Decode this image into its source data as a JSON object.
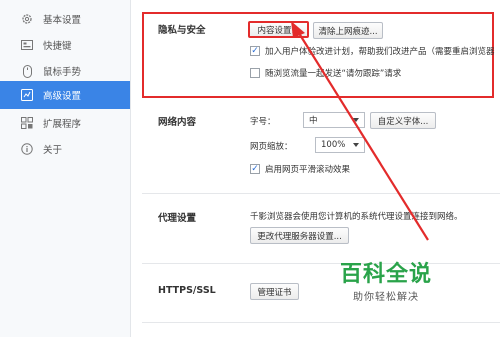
{
  "sidebar": {
    "items": [
      {
        "label": "基本设置",
        "icon": "gear-icon"
      },
      {
        "label": "快捷键",
        "icon": "keyboard-icon"
      },
      {
        "label": "鼠标手势",
        "icon": "mouse-icon"
      },
      {
        "label": "高级设置",
        "icon": "advanced-settings-icon",
        "active": true
      },
      {
        "label": "扩展程序",
        "icon": "extensions-icon"
      },
      {
        "label": "关于",
        "icon": "info-icon"
      }
    ]
  },
  "privacy": {
    "title": "隐私与安全",
    "content_settings_button": "内容设置...",
    "clear_history_button": "清除上网痕迹...",
    "checkbox_improve": {
      "label": "加入用户体验改进计划，帮助我们改进产品（需要重启浏览器",
      "checked": true
    },
    "checkbox_dnt": {
      "label": "随浏览流量一起发送“请勿跟踪”请求",
      "checked": false
    }
  },
  "web_content": {
    "title": "网络内容",
    "font_size_label": "字号：",
    "font_size_value": "中",
    "custom_font_button": "自定义字体...",
    "zoom_label": "网页缩放：",
    "zoom_value": "100%",
    "smooth_scroll": {
      "label": "启用网页平滑滚动效果",
      "checked": true
    }
  },
  "proxy": {
    "title": "代理设置",
    "description": "千影浏览器会使用您计算机的系统代理设置连接到网络。",
    "change_proxy_button": "更改代理服务器设置..."
  },
  "https": {
    "title": "HTTPS/SSL",
    "manage_certificates_button": "管理证书"
  },
  "watermark": {
    "title": "百科全说",
    "subtitle": "助你轻松解决"
  },
  "colors": {
    "accent": "#3a84e6",
    "highlight_red": "#e32b2b",
    "watermark_green": "#2aa34a"
  }
}
